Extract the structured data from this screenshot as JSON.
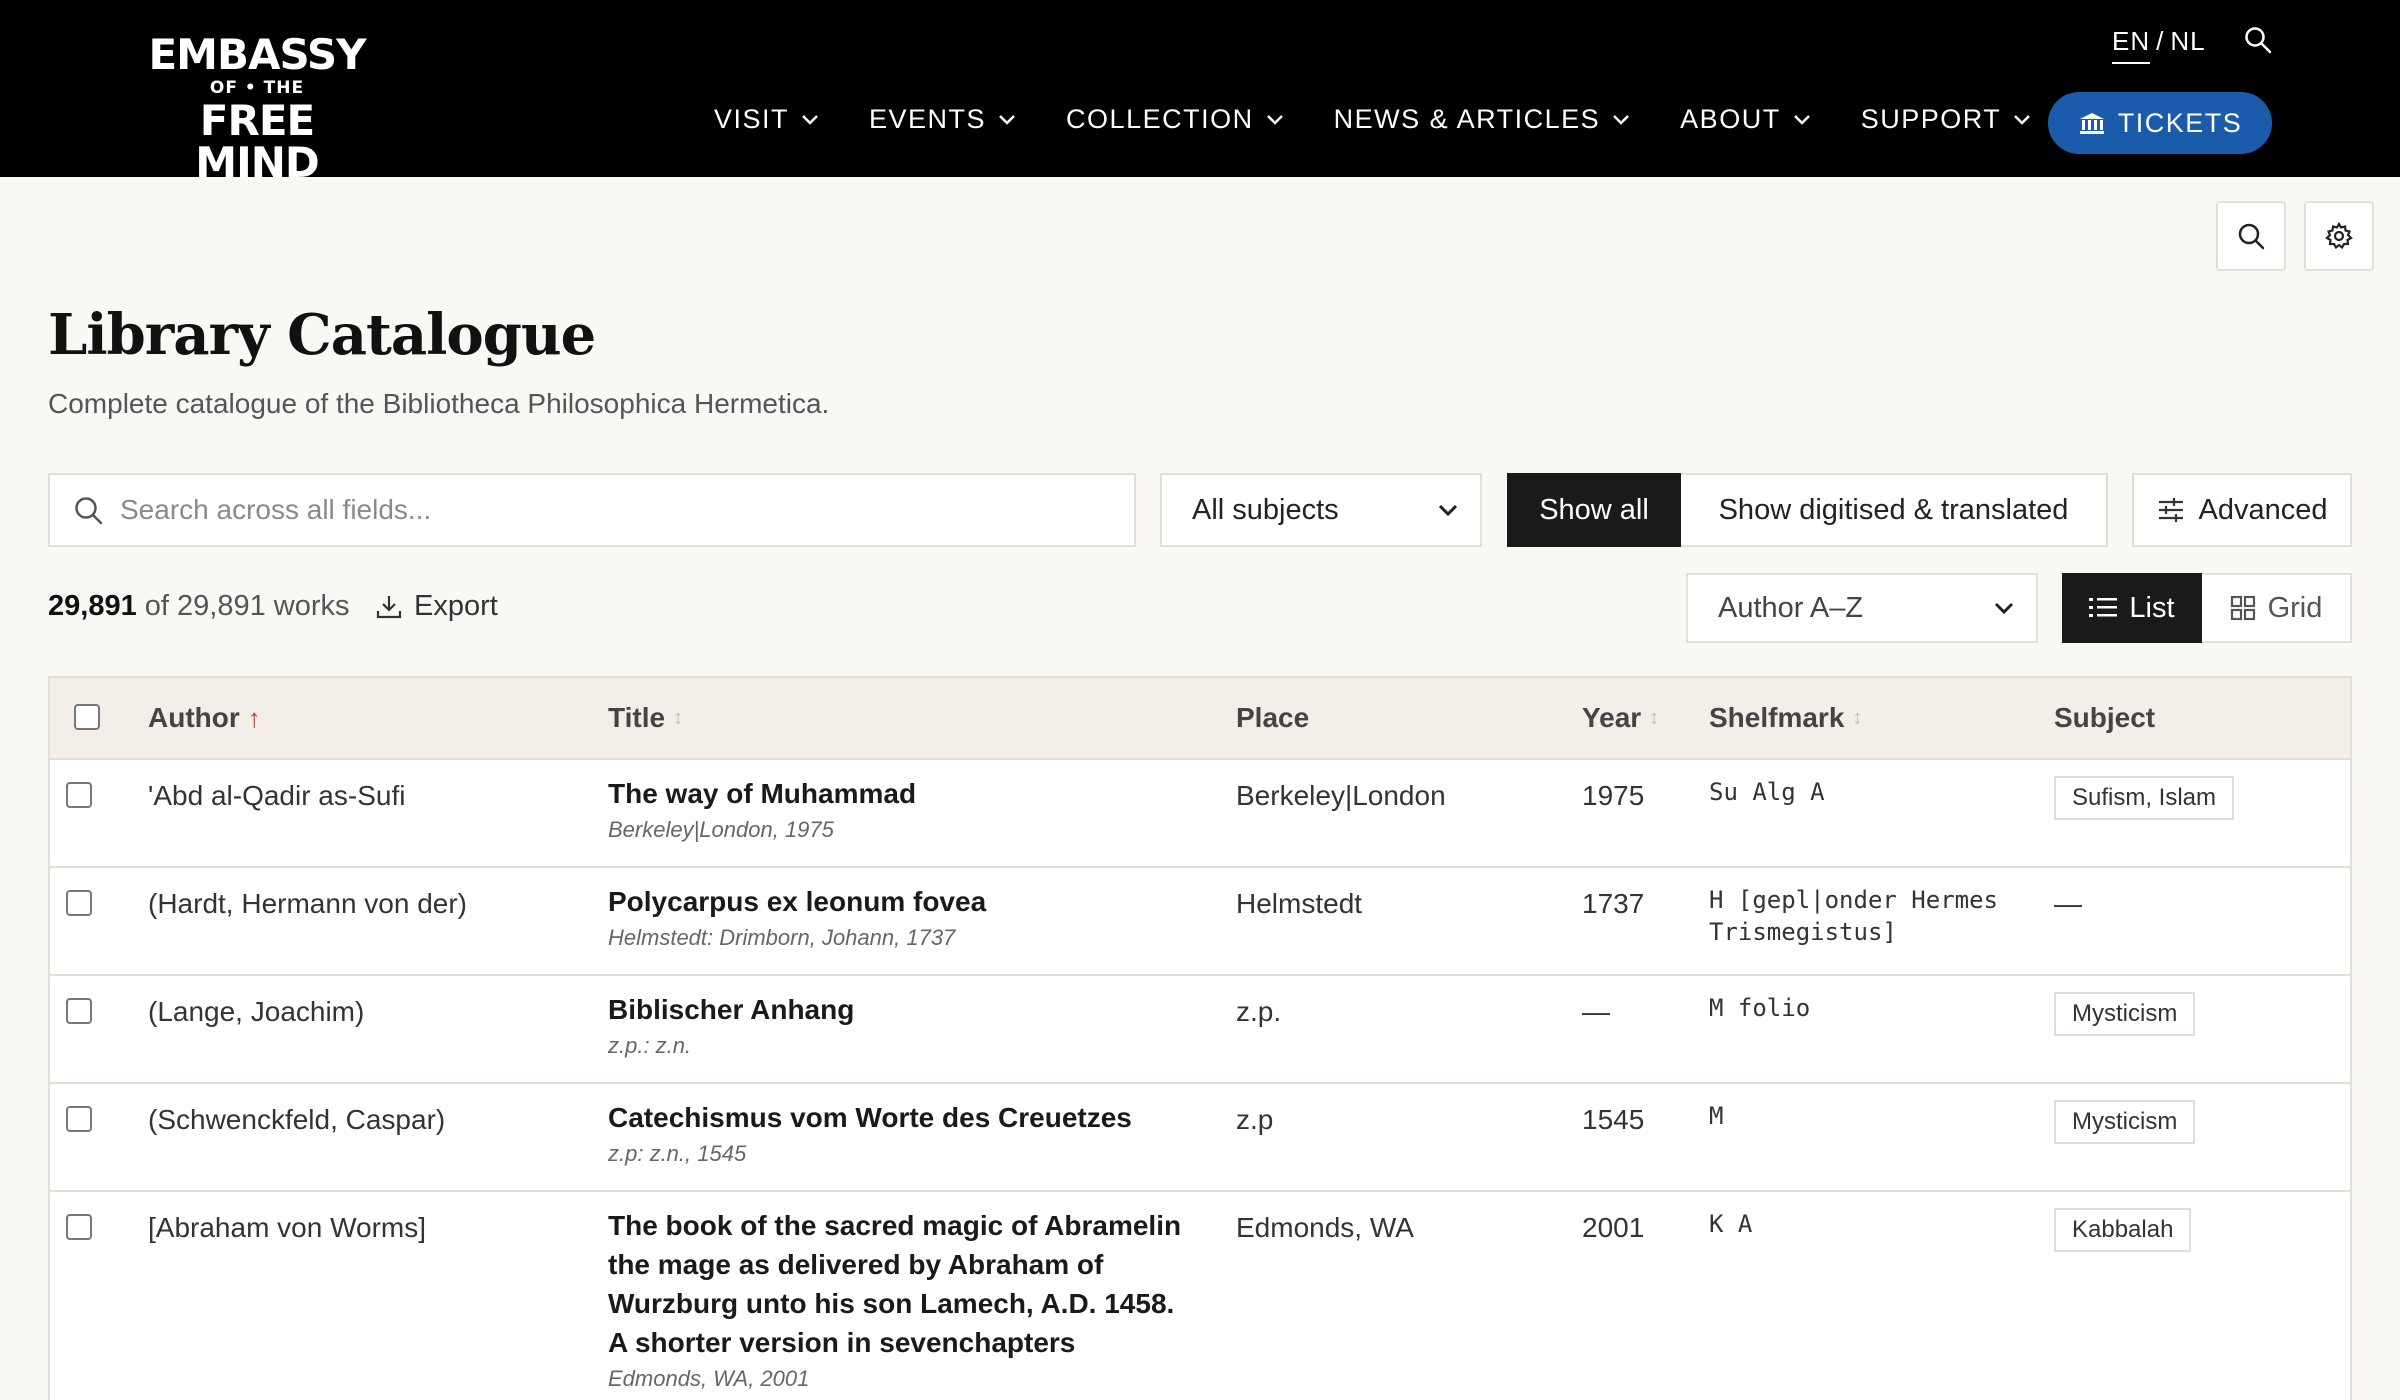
{
  "header": {
    "logo": {
      "line1": "EMBASSY",
      "line2": "OF • THE",
      "line3": "FREE MIND"
    },
    "lang": {
      "en": "EN",
      "sep": "/",
      "nl": "NL"
    },
    "nav": [
      {
        "label": "VISIT"
      },
      {
        "label": "EVENTS"
      },
      {
        "label": "COLLECTION"
      },
      {
        "label": "NEWS & ARTICLES"
      },
      {
        "label": "ABOUT"
      },
      {
        "label": "SUPPORT"
      }
    ],
    "tickets_label": "TICKETS",
    "accent_color": "#1a5cab"
  },
  "page": {
    "title": "Library Catalogue",
    "subtitle": "Complete catalogue of the Bibliotheca Philosophica Hermetica."
  },
  "filters": {
    "search_placeholder": "Search across all fields...",
    "subject_selected": "All subjects",
    "show_all_label": "Show all",
    "show_digitised_label": "Show digitised & translated",
    "advanced_label": "Advanced"
  },
  "results": {
    "count_shown": "29,891",
    "count_text": "of 29,891 works",
    "export_label": "Export",
    "sort_selected": "Author A–Z",
    "view_list_label": "List",
    "view_grid_label": "Grid"
  },
  "table": {
    "columns": {
      "author": "Author",
      "title": "Title",
      "place": "Place",
      "year": "Year",
      "shelfmark": "Shelfmark",
      "subject": "Subject"
    },
    "sort_active_icon": "↑",
    "sort_icon": "↕",
    "rows": [
      {
        "author": "'Abd al-Qadir as-Sufi",
        "title": "The way of Muhammad",
        "sub": "Berkeley|London, 1975",
        "place": "Berkeley|London",
        "year": "1975",
        "shelfmark": "Su Alg A",
        "subject": "Sufism, Islam"
      },
      {
        "author": "(Hardt, Hermann von der)",
        "title": "Polycarpus ex leonum fovea",
        "sub": "Helmstedt: Drimborn, Johann, 1737",
        "place": "Helmstedt",
        "year": "1737",
        "shelfmark": "H [gepl|onder Hermes Trismegistus]",
        "subject": "—"
      },
      {
        "author": "(Lange, Joachim)",
        "title": "Biblischer Anhang",
        "sub": "z.p.: z.n.",
        "place": "z.p.",
        "year": "—",
        "shelfmark": "M folio",
        "subject": "Mysticism"
      },
      {
        "author": "(Schwenckfeld, Caspar)",
        "title": "Catechismus vom Worte des Creuetzes",
        "sub": "z.p: z.n., 1545",
        "place": "z.p",
        "year": "1545",
        "shelfmark": "M",
        "subject": "Mysticism"
      },
      {
        "author": "[Abraham von Worms]",
        "title": "The book of the sacred magic of Abramelin the mage as delivered by Abraham of Wurzburg unto his son Lamech, A.D. 1458. A shorter version in sevenchapters",
        "sub": "Edmonds, WA, 2001",
        "place": "Edmonds, WA",
        "year": "2001",
        "shelfmark": "K A",
        "subject": "Kabbalah"
      }
    ]
  }
}
